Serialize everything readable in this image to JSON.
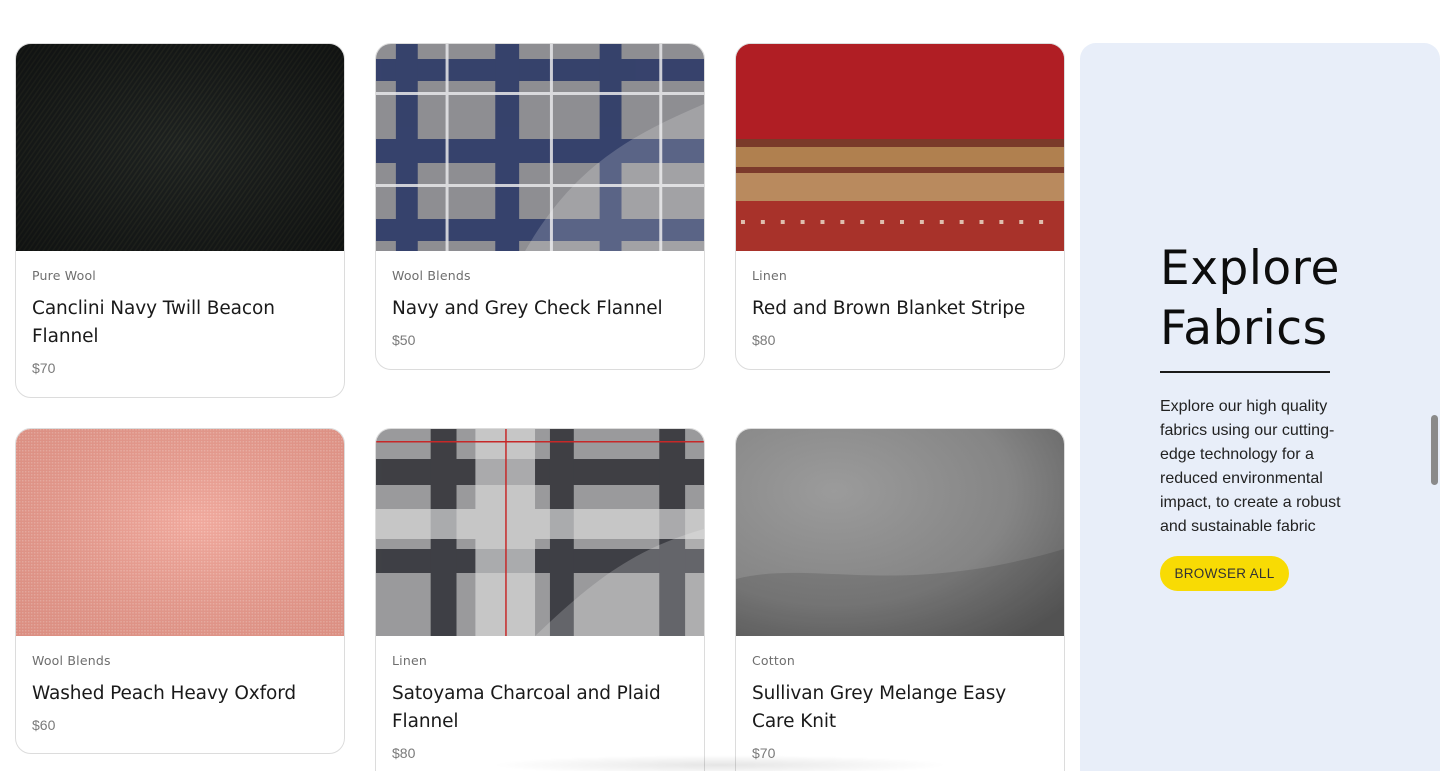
{
  "products": [
    {
      "category": "Pure Wool",
      "title": "Canclini Navy Twill Beacon Flannel",
      "price": "$70"
    },
    {
      "category": "Wool Blends",
      "title": "Navy and Grey Check Flannel",
      "price": "$50"
    },
    {
      "category": "Linen",
      "title": "Red and Brown Blanket Stripe",
      "price": "$80"
    },
    {
      "category": "Wool Blends",
      "title": "Washed Peach Heavy Oxford",
      "price": "$60"
    },
    {
      "category": "Linen",
      "title": "Satoyama Charcoal and Plaid Flannel",
      "price": "$80"
    },
    {
      "category": "Cotton",
      "title": "Sullivan Grey Melange Easy Care Knit",
      "price": "$70"
    }
  ],
  "explore": {
    "heading": "Explore Fabrics",
    "description": "Explore our high quality fabrics using our cutting-edge technology for a reduced environmental impact, to create a robust and sustainable fabric",
    "button_label": "BROWSER ALL"
  },
  "colors": {
    "panel_background": "#e8eef9",
    "button_accent": "#f8db04"
  }
}
